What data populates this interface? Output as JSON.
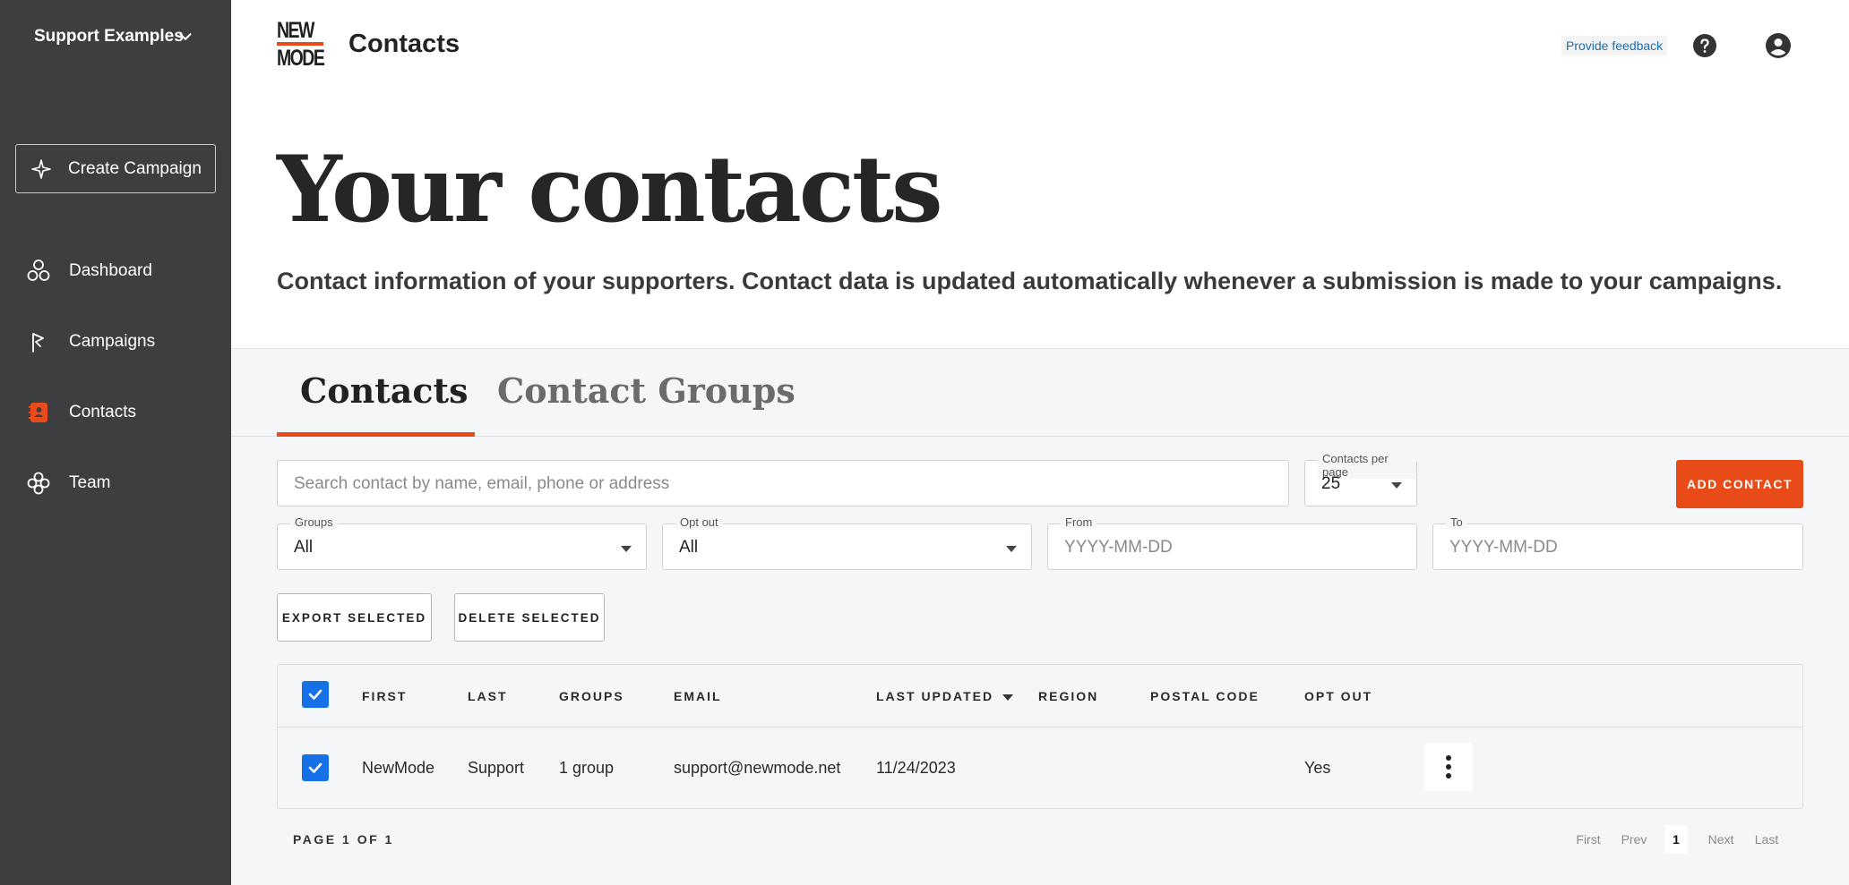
{
  "sidebar": {
    "org_name": "Support Examples",
    "create_campaign": "Create Campaign",
    "items": [
      {
        "label": "Dashboard",
        "icon": "dashboard-icon"
      },
      {
        "label": "Campaigns",
        "icon": "campaigns-flag-icon"
      },
      {
        "label": "Contacts",
        "icon": "contacts-book-icon",
        "active": true
      },
      {
        "label": "Team",
        "icon": "team-icon"
      }
    ],
    "accent": "#e94b1b",
    "background": "#3d3e40"
  },
  "header": {
    "logo_line1": "NEW",
    "logo_line2": "MODE",
    "title": "Contacts",
    "feedback": "Provide feedback",
    "help_icon": "help-circle-icon",
    "user_icon": "account-circle-icon"
  },
  "hero": {
    "heading": "Your contacts",
    "description": "Contact information of your supporters. Contact data is updated automatically whenever a submission is made to your campaigns."
  },
  "tabs": [
    {
      "label": "Contacts",
      "active": true
    },
    {
      "label": "Contact Groups",
      "active": false
    }
  ],
  "filters": {
    "search_placeholder": "Search contact by name, email, phone or address",
    "per_page_label": "Contacts per page",
    "per_page_value": "25",
    "add_contact": "ADD CONTACT",
    "groups_label": "Groups",
    "groups_value": "All",
    "optout_label": "Opt out",
    "optout_value": "All",
    "from_label": "From",
    "from_placeholder": "YYYY-MM-DD",
    "to_label": "To",
    "to_placeholder": "YYYY-MM-DD"
  },
  "actions": {
    "export": "EXPORT SELECTED",
    "delete": "DELETE SELECTED"
  },
  "table": {
    "columns": [
      "FIRST",
      "LAST",
      "GROUPS",
      "EMAIL",
      "LAST UPDATED",
      "REGION",
      "POSTAL CODE",
      "OPT OUT"
    ],
    "rows": [
      {
        "first": "NewMode",
        "last": "Support",
        "groups": "1 group",
        "email": "support@newmode.net",
        "last_updated": "11/24/2023",
        "region": "",
        "postal_code": "",
        "opt_out": "Yes",
        "checked": true
      }
    ]
  },
  "pagination": {
    "info": "PAGE 1 OF 1",
    "first": "First",
    "prev": "Prev",
    "current": "1",
    "next": "Next",
    "last": "Last"
  }
}
